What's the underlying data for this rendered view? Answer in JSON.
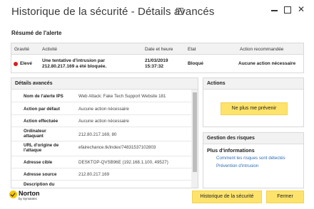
{
  "window": {
    "title": "Historique de la sécurité - Détails avancés",
    "help_symbol": "?",
    "close_symbol": "✕"
  },
  "alert_summary": {
    "section_title": "Résumé de l'alerte",
    "headers": {
      "gravity": "Gravité",
      "activity": "Activité",
      "datetime": "Date et heure",
      "state": "Etat",
      "recommended": "Action recommandée"
    },
    "row": {
      "gravity": "Elevé",
      "gravity_color": "#d81e1e",
      "activity_line1": "Une tentative d'intrusion par",
      "activity_line2": "212.80.217.169 a été bloquée.",
      "date": "21/03/2019",
      "time": "15:37:32",
      "state": "Bloqué",
      "recommended": "Aucune action nécessaire"
    }
  },
  "details": {
    "title": "Détails avancés",
    "rows": [
      {
        "label": "Nom de l'alerte IPS",
        "value": "Web Attack: Fake Tech Support Website 181"
      },
      {
        "label": "Action par défaut",
        "value": "Aucune action nécessaire"
      },
      {
        "label": "Action effectuée",
        "value": "Aucune action nécessaire"
      },
      {
        "label_1": "Ordinateur",
        "label_2": "attaquant",
        "value": "212.80.217.169, 80"
      },
      {
        "label_1": "URL d'origine de",
        "label_2": "l'attaque",
        "value": "efairechance.tk/index/74831537102803"
      },
      {
        "label": "Adresse cible",
        "value": "DESKTOP-QVSB96E (192.168.1.100, 49527)"
      },
      {
        "label": "Adresse source",
        "value": "212.80.217.169"
      },
      {
        "label": "Description du",
        "value": ""
      }
    ]
  },
  "actions": {
    "title": "Actions",
    "button": "Ne plus me prévenir"
  },
  "risk": {
    "title": "Gestion des risques",
    "subtitle": "Plus d'informations",
    "links": [
      "Comment les risques sont détectés",
      "Prévention d'intrusion"
    ]
  },
  "footer": {
    "logo_name": "Norton",
    "logo_sub": "by Symantec",
    "history_button": "Historique de la sécurité",
    "close_button": "Fermer"
  },
  "colors": {
    "accent_yellow": "#fde36b",
    "link_blue": "#2f6db5"
  }
}
